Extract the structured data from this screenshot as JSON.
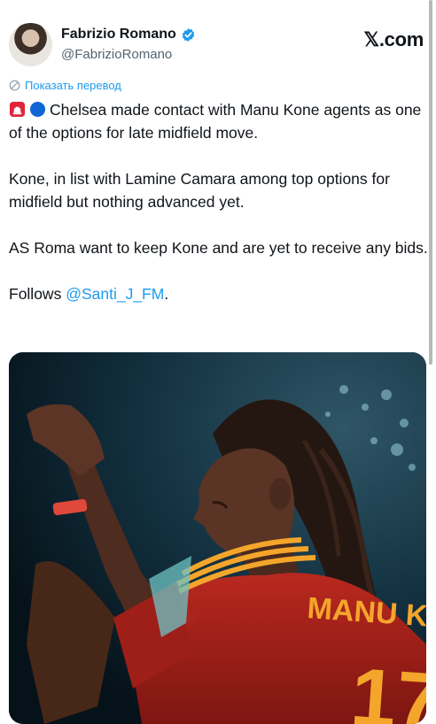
{
  "header": {
    "name": "Fabrizio Romano",
    "handle": "@FabrizioRomano",
    "brand": "𝕏.com",
    "verified_color": "#1d9bf0"
  },
  "translate_link": "Показать перевод",
  "tweet": {
    "line1": "Chelsea made contact with Manu Kone agents as one of the options for late midfield move.",
    "line2": "Kone, in list with Lamine Camara among top options for midfield but nothing advanced yet.",
    "line3": "AS Roma want to keep Kone and are yet to receive any bids.",
    "follows_prefix": "Follows ",
    "mention": "@Santi_J_FM",
    "follows_suffix": "."
  },
  "media": {
    "jersey_name": "MANU KONE",
    "jersey_number": "17"
  },
  "colors": {
    "link": "#1d9bf0",
    "jersey_red": "#b2231b",
    "jersey_orange": "#f4a52b"
  }
}
